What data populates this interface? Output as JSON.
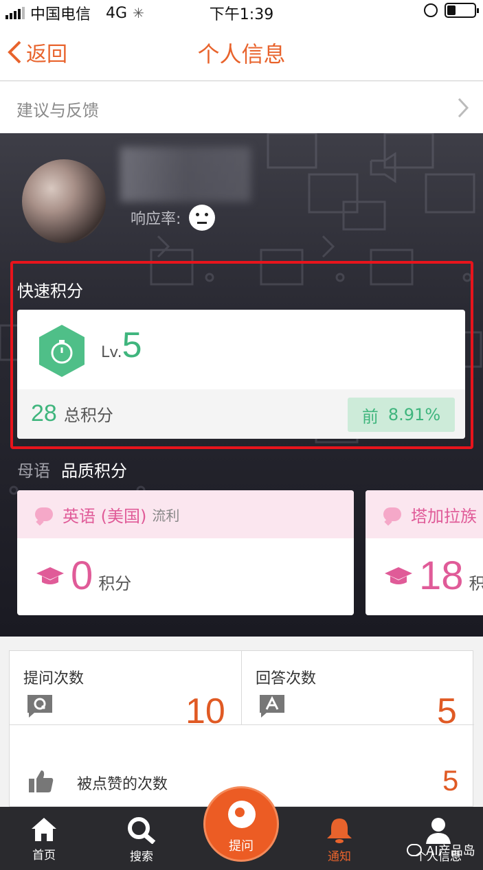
{
  "status_bar": {
    "carrier": "中国电信",
    "network": "4G",
    "time": "下午1:39"
  },
  "nav": {
    "back_label": "返回",
    "title": "个人信息"
  },
  "feedback": {
    "label": "建议与反馈"
  },
  "profile": {
    "response_label": "响应率:"
  },
  "quick_points": {
    "heading": "快速积分",
    "level_prefix": "Lv.",
    "level": "5",
    "total": "28",
    "total_label": "总积分",
    "rank_prefix": "前",
    "rank_value": "8.91%"
  },
  "quality": {
    "native_tab": "母语",
    "quality_tab": "品质积分",
    "languages": [
      {
        "name": "英语 (美国)",
        "fluency": "流利",
        "points": "0",
        "unit": "积分"
      },
      {
        "name": "塔加拉族",
        "fluency": "",
        "points": "18",
        "unit": "积"
      }
    ]
  },
  "stats": {
    "ask_label": "提问次数",
    "ask_count": "10",
    "answer_label": "回答次数",
    "answer_count": "5",
    "like_label": "被点赞的次数",
    "like_count": "5"
  },
  "tabbar": {
    "home": "首页",
    "search": "搜索",
    "ask": "提问",
    "notify": "通知",
    "profile": "个人信息"
  },
  "watermark": "AI产品岛",
  "colors": {
    "accent": "#e8632c",
    "green": "#3fb57d",
    "pink": "#e05b98",
    "highlight": "#e8141c"
  }
}
